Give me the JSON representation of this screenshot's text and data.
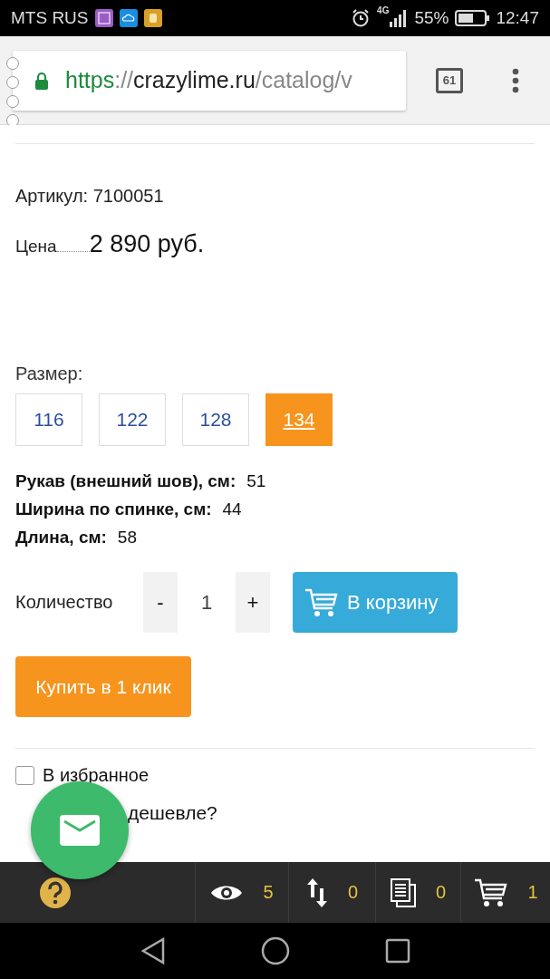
{
  "status_bar": {
    "carrier": "MTS RUS",
    "network": "4G",
    "battery": "55%",
    "time": "12:47"
  },
  "browser": {
    "url_scheme": "https",
    "url_sep": "://",
    "url_host": "crazylime.ru",
    "url_path": "/catalog/v",
    "tab_count": "61"
  },
  "product": {
    "sku": "Артикул: 7100051",
    "price_label": "Цена",
    "price": "2 890 руб.",
    "size_label": "Размер:",
    "sizes": [
      {
        "label": "116",
        "selected": false
      },
      {
        "label": "122",
        "selected": false
      },
      {
        "label": "128",
        "selected": false
      },
      {
        "label": "134",
        "selected": true
      }
    ],
    "specs": [
      {
        "label": "Рукав (внешний шов), см:",
        "value": "51"
      },
      {
        "label": "Ширина по спинке, см:",
        "value": "44"
      },
      {
        "label": "Длина, см:",
        "value": "58"
      }
    ],
    "quantity_label": "Количество",
    "minus": "-",
    "quantity": "1",
    "plus": "+",
    "cart_button": "В корзину",
    "buy_button": "Купить в 1 клик",
    "favorite": {
      "label": "В избранное",
      "checked": false
    },
    "cheaper": "дешевле?"
  },
  "bottom_bar": [
    {
      "kind": "help"
    },
    {
      "kind": "views",
      "count": "5"
    },
    {
      "kind": "compare",
      "count": "0"
    },
    {
      "kind": "docs",
      "count": "0"
    },
    {
      "kind": "cart",
      "count": "1"
    }
  ]
}
